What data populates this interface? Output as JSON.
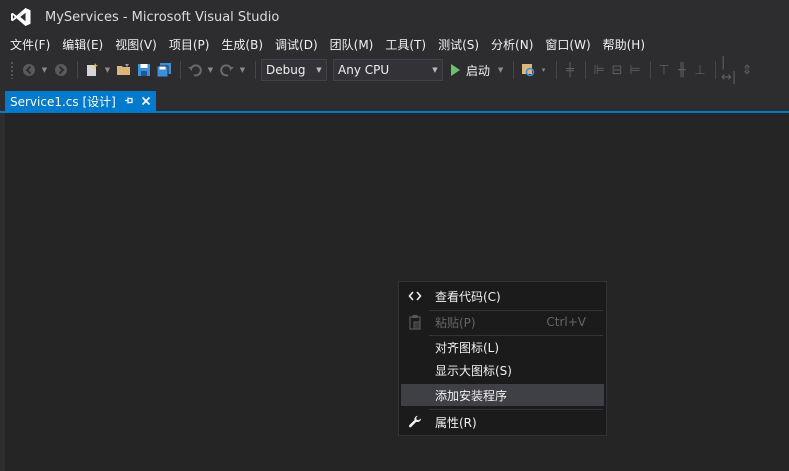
{
  "window": {
    "title": "MyServices - Microsoft Visual Studio"
  },
  "menubar": {
    "items": [
      "文件(F)",
      "编辑(E)",
      "视图(V)",
      "项目(P)",
      "生成(B)",
      "调试(D)",
      "团队(M)",
      "工具(T)",
      "测试(S)",
      "分析(N)",
      "窗口(W)",
      "帮助(H)"
    ]
  },
  "toolbar": {
    "configuration": "Debug",
    "platform": "Any CPU",
    "start_label": "启动"
  },
  "tab": {
    "label": "Service1.cs [设计]"
  },
  "context_menu": {
    "items": [
      {
        "label": "查看代码(C)",
        "shortcut": "",
        "icon": "code-icon",
        "enabled": true
      },
      {
        "label": "粘贴(P)",
        "shortcut": "Ctrl+V",
        "icon": "paste-icon",
        "enabled": false
      },
      {
        "label": "对齐图标(L)",
        "shortcut": "",
        "icon": "",
        "enabled": true
      },
      {
        "label": "显示大图标(S)",
        "shortcut": "",
        "icon": "",
        "enabled": true
      },
      {
        "label": "添加安装程序",
        "shortcut": "",
        "icon": "",
        "enabled": true,
        "highlighted": true
      },
      {
        "label": "属性(R)",
        "shortcut": "",
        "icon": "wrench-icon",
        "enabled": true
      }
    ]
  },
  "colors": {
    "accent": "#007acc",
    "chrome": "#2d2d30",
    "surface": "#252526",
    "menu_bg": "#1b1b1c",
    "menu_hover": "#3f3f46",
    "vs_purple": "#865fc5",
    "run_green": "#6fc06a"
  }
}
